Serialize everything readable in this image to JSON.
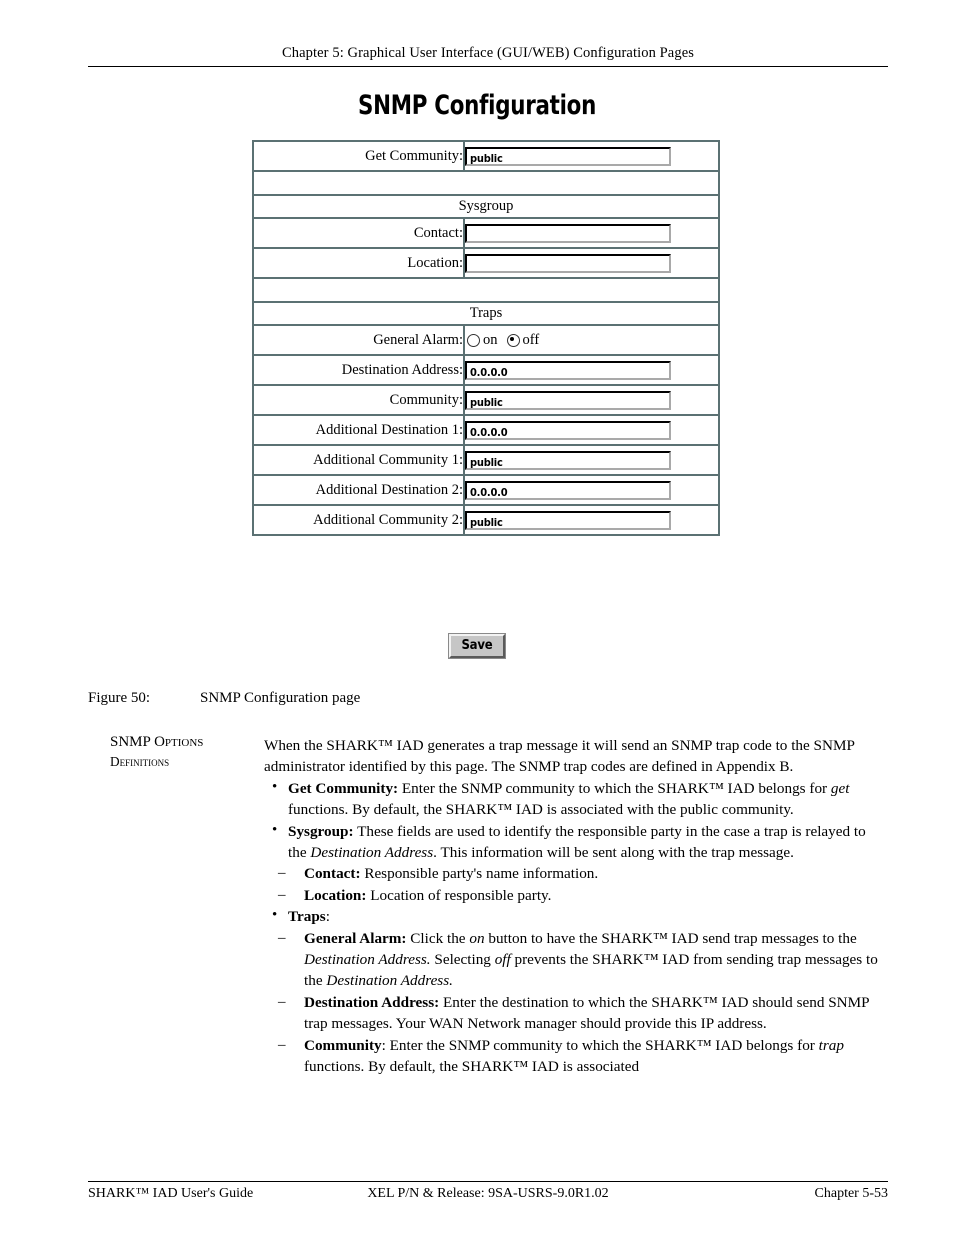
{
  "header": {
    "running_head": "Chapter 5: Graphical User Interface (GUI/WEB) Configuration Pages"
  },
  "page_title": "SNMP Configuration",
  "form": {
    "rows": [
      {
        "type": "field",
        "label": "Get Community:",
        "value": "public"
      },
      {
        "type": "spacer"
      },
      {
        "type": "section",
        "label": "Sysgroup"
      },
      {
        "type": "field",
        "label": "Contact:",
        "value": ""
      },
      {
        "type": "field",
        "label": "Location:",
        "value": ""
      },
      {
        "type": "spacer"
      },
      {
        "type": "section",
        "label": "Traps"
      },
      {
        "type": "radio",
        "label": "General Alarm:",
        "options": [
          {
            "label": "on",
            "selected": false
          },
          {
            "label": "off",
            "selected": true
          }
        ]
      },
      {
        "type": "field",
        "label": "Destination Address:",
        "value": "0.0.0.0"
      },
      {
        "type": "field",
        "label": "Community:",
        "value": "public"
      },
      {
        "type": "field",
        "label": "Additional Destination 1:",
        "value": "0.0.0.0"
      },
      {
        "type": "field",
        "label": "Additional Community 1:",
        "value": "public"
      },
      {
        "type": "field",
        "label": "Additional Destination 2:",
        "value": "0.0.0.0"
      },
      {
        "type": "field",
        "label": "Additional Community 2:",
        "value": "public"
      }
    ],
    "save_label": "Save"
  },
  "figure": {
    "number": "Figure 50:",
    "caption": "SNMP Configuration page"
  },
  "side_label": {
    "line1_lead": "SNMP",
    "line1_rest": "Options",
    "line2": "Definitions"
  },
  "intro": "When the SHARK™ IAD generates a trap message it will send an SNMP trap code to the SNMP administrator identified by this page.  The SNMP trap codes are defined in Appendix B.",
  "bullets": [
    {
      "level": 1,
      "marker": "•",
      "term": "Get Community:",
      "term_bold": true,
      "colon_inside": true,
      "text": " Enter the SNMP community to which the SHARK™ IAD belongs for ",
      "em1": "get",
      "text2": " functions.  By default, the SHARK™ IAD is associated with the public community."
    },
    {
      "level": 1,
      "marker": "•",
      "term": "Sysgroup:",
      "term_bold": true,
      "colon_inside": true,
      "text": "  These fields are used to identify the responsible party in the case a trap is relayed to the ",
      "em1": "Destination Address",
      "text2": ".  This information will be sent along with the trap message."
    },
    {
      "level": 2,
      "marker": "–",
      "term": "Contact:",
      "term_bold": true,
      "colon_inside": true,
      "text": "  Responsible party's name information.",
      "em1": "",
      "text2": ""
    },
    {
      "level": 2,
      "marker": "–",
      "term": "Location:",
      "term_bold": true,
      "colon_inside": true,
      "text": "   Location of responsible party.",
      "em1": "",
      "text2": ""
    },
    {
      "level": 1,
      "marker": "•",
      "term": "Traps",
      "term_bold": true,
      "colon_inside": false,
      "text": ":",
      "em1": "",
      "text2": ""
    },
    {
      "level": 2,
      "marker": "–",
      "term": "General Alarm:",
      "term_bold": true,
      "colon_inside": true,
      "text": " Click the ",
      "em1": "on",
      "text2": " button to have the SHARK™ IAD send trap messages to the ",
      "em2": "Destination Address.",
      "text3": "  Selecting ",
      "em3": "off",
      "text4": " prevents the SHARK™ IAD from sending trap messages to the ",
      "em4": "Destination Address.",
      "text5": ""
    },
    {
      "level": 2,
      "marker": "–",
      "term": "Destination Address:",
      "term_bold": true,
      "colon_inside": true,
      "text": " Enter the destination to which the SHARK™ IAD should send SNMP trap messages.  Your WAN Network manager should provide this IP address.",
      "em1": "",
      "text2": ""
    },
    {
      "level": 2,
      "marker": "–",
      "term": "Community",
      "term_bold": true,
      "colon_inside": false,
      "text": ": Enter the SNMP community to which the SHARK™ IAD belongs for ",
      "em1": "trap",
      "text2": " functions.  By default, the SHARK™ IAD is associated"
    }
  ],
  "footer": {
    "left": "SHARK™ IAD User's Guide",
    "center": "XEL P/N & Release: 9SA-USRS-9.0R1.02",
    "right": "Chapter 5-53"
  }
}
